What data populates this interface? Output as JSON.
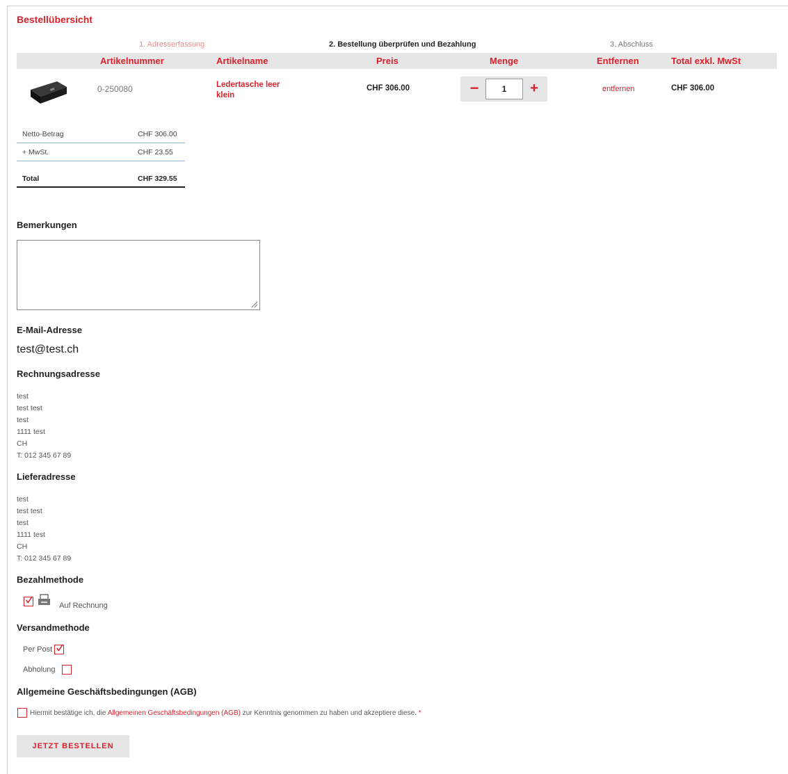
{
  "page": {
    "title": "Bestellübersicht"
  },
  "steps": [
    {
      "label": "1. Adresserfassung"
    },
    {
      "label": "2. Bestellung überprüfen und Bezahlung"
    },
    {
      "label": "3. Abschluss"
    }
  ],
  "table": {
    "headers": {
      "article_number": "Artikelnummer",
      "article_name": "Artikelname",
      "price": "Preis",
      "quantity": "Menge",
      "remove": "Entfernen",
      "total_excl": "Total exkl. MwSt"
    },
    "rows": [
      {
        "article_number": "0-250080",
        "article_name": "Ledertasche leer klein",
        "price": "CHF 306.00",
        "quantity": "1",
        "quantity_minus": "−",
        "quantity_plus": "+",
        "remove": "entfernen",
        "total_excl": "CHF 306.00"
      }
    ]
  },
  "summary": [
    {
      "label": "Netto-Betrag",
      "value": "CHF 306.00"
    },
    {
      "label": "+ MwSt.",
      "value": "CHF 23.55"
    },
    {
      "label": "Total",
      "value": "CHF 329.55"
    }
  ],
  "remarks": {
    "heading": "Bemerkungen",
    "value": ""
  },
  "email": {
    "heading": "E-Mail-Adresse",
    "value": "test@test.ch"
  },
  "billing": {
    "heading": "Rechnungsadresse",
    "lines": [
      "test",
      "test test",
      "test",
      "1111 test",
      "CH",
      "T: 012 345 67 89"
    ]
  },
  "shipping_address": {
    "heading": "Lieferadresse",
    "lines": [
      "test",
      "test test",
      "test",
      "1111 test",
      "CH",
      "T: 012 345 67 89"
    ]
  },
  "payment": {
    "heading": "Bezahlmethode",
    "options": [
      {
        "label": "Auf Rechnung",
        "checked": true,
        "icon": "invoice-icon"
      }
    ]
  },
  "shipping_method": {
    "heading": "Versandmethode",
    "options": [
      {
        "label": "Per Post",
        "checked": true
      },
      {
        "label": "Abholung",
        "checked": false
      }
    ]
  },
  "terms": {
    "heading": "Allgemeine Geschäftsbedingungen (AGB)",
    "text_before": "Hiermit bestätige ich, die",
    "link": "Allgemeinen Geschäftsbedingungen (AGB)",
    "text_after": "zur Kenntnis genommen zu haben und akzeptiere diese.",
    "required_mark": "*",
    "checked": false
  },
  "submit": {
    "label": "JETZT BESTELLEN"
  },
  "colors": {
    "accent": "#d9212c",
    "header_bg": "#e6e6e6",
    "divider": "#8fb3d9"
  }
}
